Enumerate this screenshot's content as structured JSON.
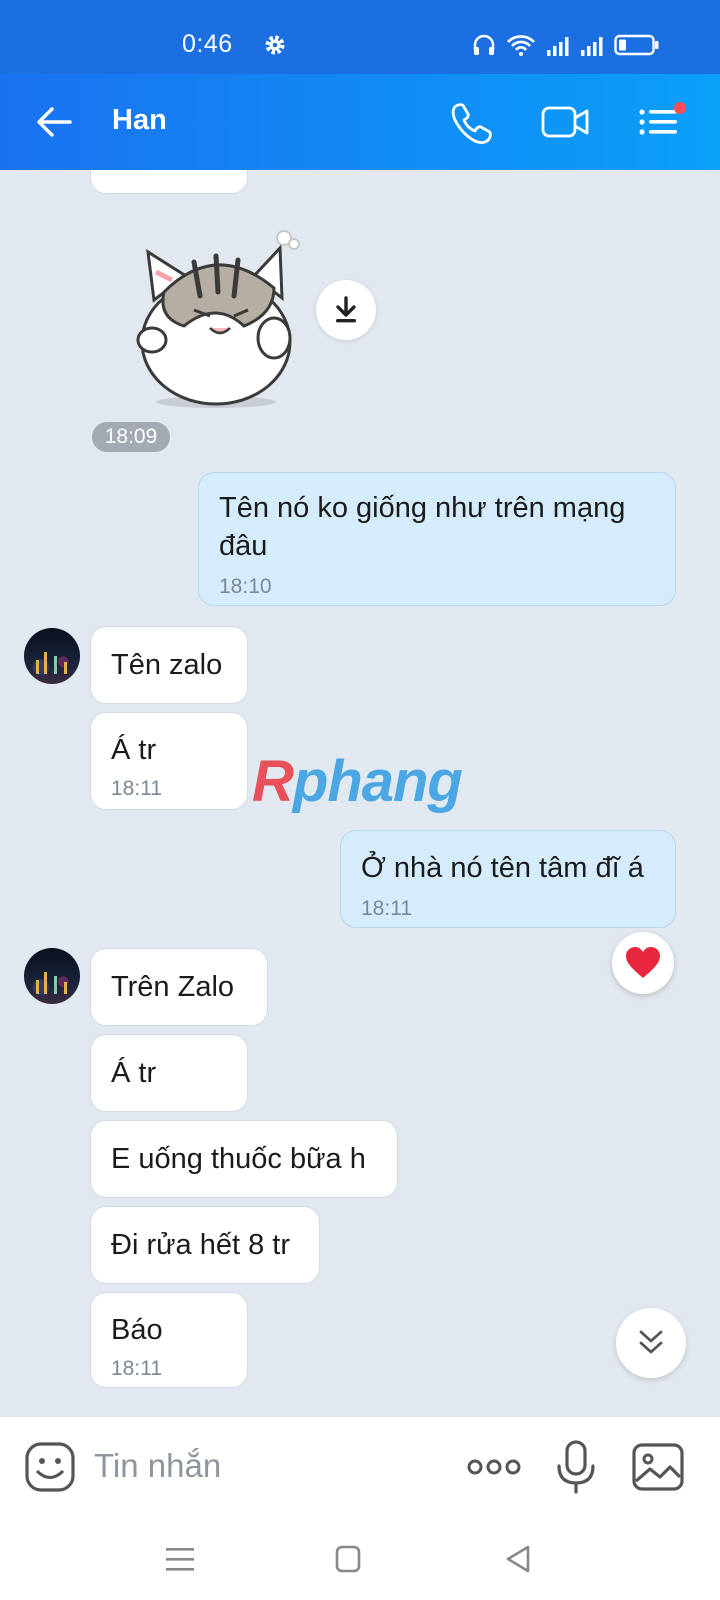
{
  "status": {
    "time": "0:46"
  },
  "header": {
    "contact_name": "Han"
  },
  "chat": {
    "sticker_time": "18:09",
    "messages": [
      {
        "dir": "out",
        "lines": [
          "Tên nó ko giống như trên mạng",
          "đâu"
        ],
        "time": "18:10"
      },
      {
        "dir": "in",
        "text": "Tên zalo"
      },
      {
        "dir": "in",
        "text": "Á tr",
        "time": "18:11"
      },
      {
        "dir": "out",
        "text": "Ở nhà nó tên tâm đĩ á",
        "time": "18:11"
      },
      {
        "dir": "in",
        "text": "Trên Zalo"
      },
      {
        "dir": "in",
        "text": "Á tr"
      },
      {
        "dir": "in",
        "text": "E uống thuốc bữa h"
      },
      {
        "dir": "in",
        "text": "Đi rửa hết 8 tr"
      },
      {
        "dir": "in",
        "text": "Báo",
        "time": "18:11"
      }
    ],
    "watermark": {
      "first": "R",
      "rest": "phang"
    }
  },
  "input": {
    "placeholder": "Tin nhắn"
  },
  "colors": {
    "header_start": "#1a72f0",
    "header_end": "#0aa0f8",
    "outgoing_bubble": "#d4ecfc",
    "incoming_bubble": "#ffffff",
    "chat_bg": "#e2e8ef"
  },
  "icons": [
    "gear-icon",
    "headphones-icon",
    "wifi-icon",
    "signal-icon",
    "battery-icon",
    "back-arrow-icon",
    "phone-icon",
    "video-icon",
    "menu-icon",
    "download-icon",
    "heart-icon",
    "double-chevron-down-icon",
    "emoji-icon",
    "more-icon",
    "microphone-icon",
    "image-icon"
  ]
}
